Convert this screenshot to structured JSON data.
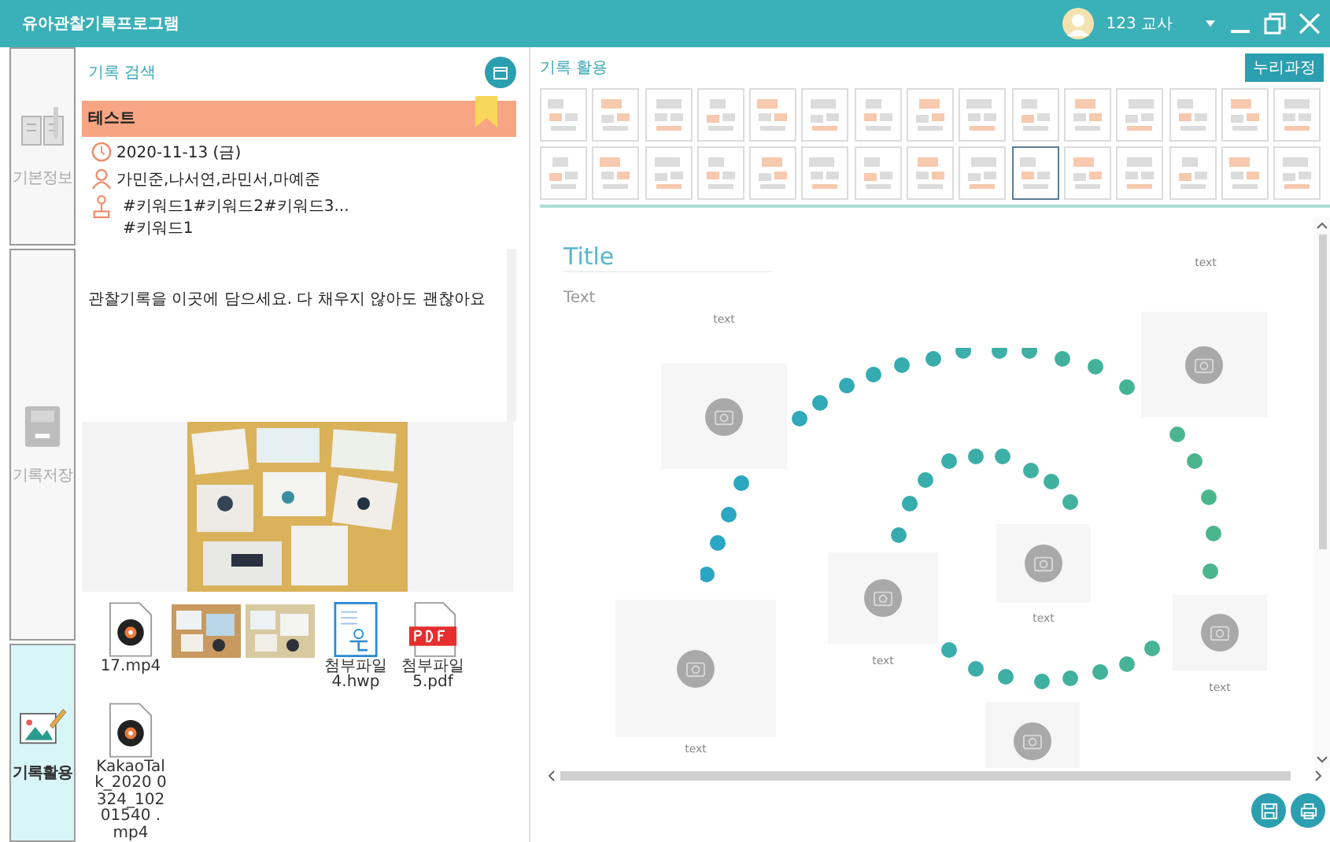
{
  "window": {
    "title": "유아관찰기록프로그램",
    "user": "123 교사"
  },
  "nav": [
    {
      "label": "기본정보",
      "kind": "book",
      "selected": false
    },
    {
      "label": "기록저장",
      "kind": "save",
      "selected": false
    },
    {
      "label": "기록활용",
      "kind": "picture",
      "selected": true
    }
  ],
  "search": {
    "heading": "기록 검색",
    "record": {
      "title": "테스트",
      "selected": true,
      "bookmarked": true,
      "date": "2020-11-13 (금)",
      "children": "가민준,나서연,라민서,마예준",
      "keywords": [
        "#키워드1#키워드2#키워드3...",
        "#키워드1"
      ]
    },
    "note": "관찰기록을 이곳에 담으세요. 다 채우지 않아도 괜찮아요",
    "attachments": [
      {
        "kind": "video",
        "name": "17.mp4"
      },
      {
        "kind": "picture"
      },
      {
        "kind": "picture"
      },
      {
        "kind": "hwp",
        "name": "첨부파일4.hwp"
      },
      {
        "kind": "pdf",
        "name": "첨부파일5.pdf"
      },
      {
        "kind": "video",
        "name": "KakaoTalk_2020 0324_10201540 .mp4"
      }
    ]
  },
  "use": {
    "heading": "기록 활용",
    "curriculum_button": "누리과정",
    "templates": [
      {
        "selected": false
      },
      {
        "selected": false
      },
      {
        "selected": false
      },
      {
        "selected": false
      },
      {
        "selected": false
      },
      {
        "selected": false
      },
      {
        "selected": false
      },
      {
        "selected": false
      },
      {
        "selected": false
      },
      {
        "selected": false
      },
      {
        "selected": false
      },
      {
        "selected": false
      },
      {
        "selected": false
      },
      {
        "selected": false
      },
      {
        "selected": false
      },
      {
        "selected": false
      },
      {
        "selected": false
      },
      {
        "selected": false
      },
      {
        "selected": false
      },
      {
        "selected": false
      },
      {
        "selected": false
      },
      {
        "selected": false
      },
      {
        "selected": false
      },
      {
        "selected": false
      },
      {
        "selected": true
      },
      {
        "selected": false
      },
      {
        "selected": false
      },
      {
        "selected": false
      },
      {
        "selected": false
      },
      {
        "selected": false
      }
    ],
    "canvas": {
      "title": "Title",
      "text": "Text",
      "labels": [
        "text",
        "text",
        "text",
        "text",
        "text",
        "text"
      ]
    }
  }
}
